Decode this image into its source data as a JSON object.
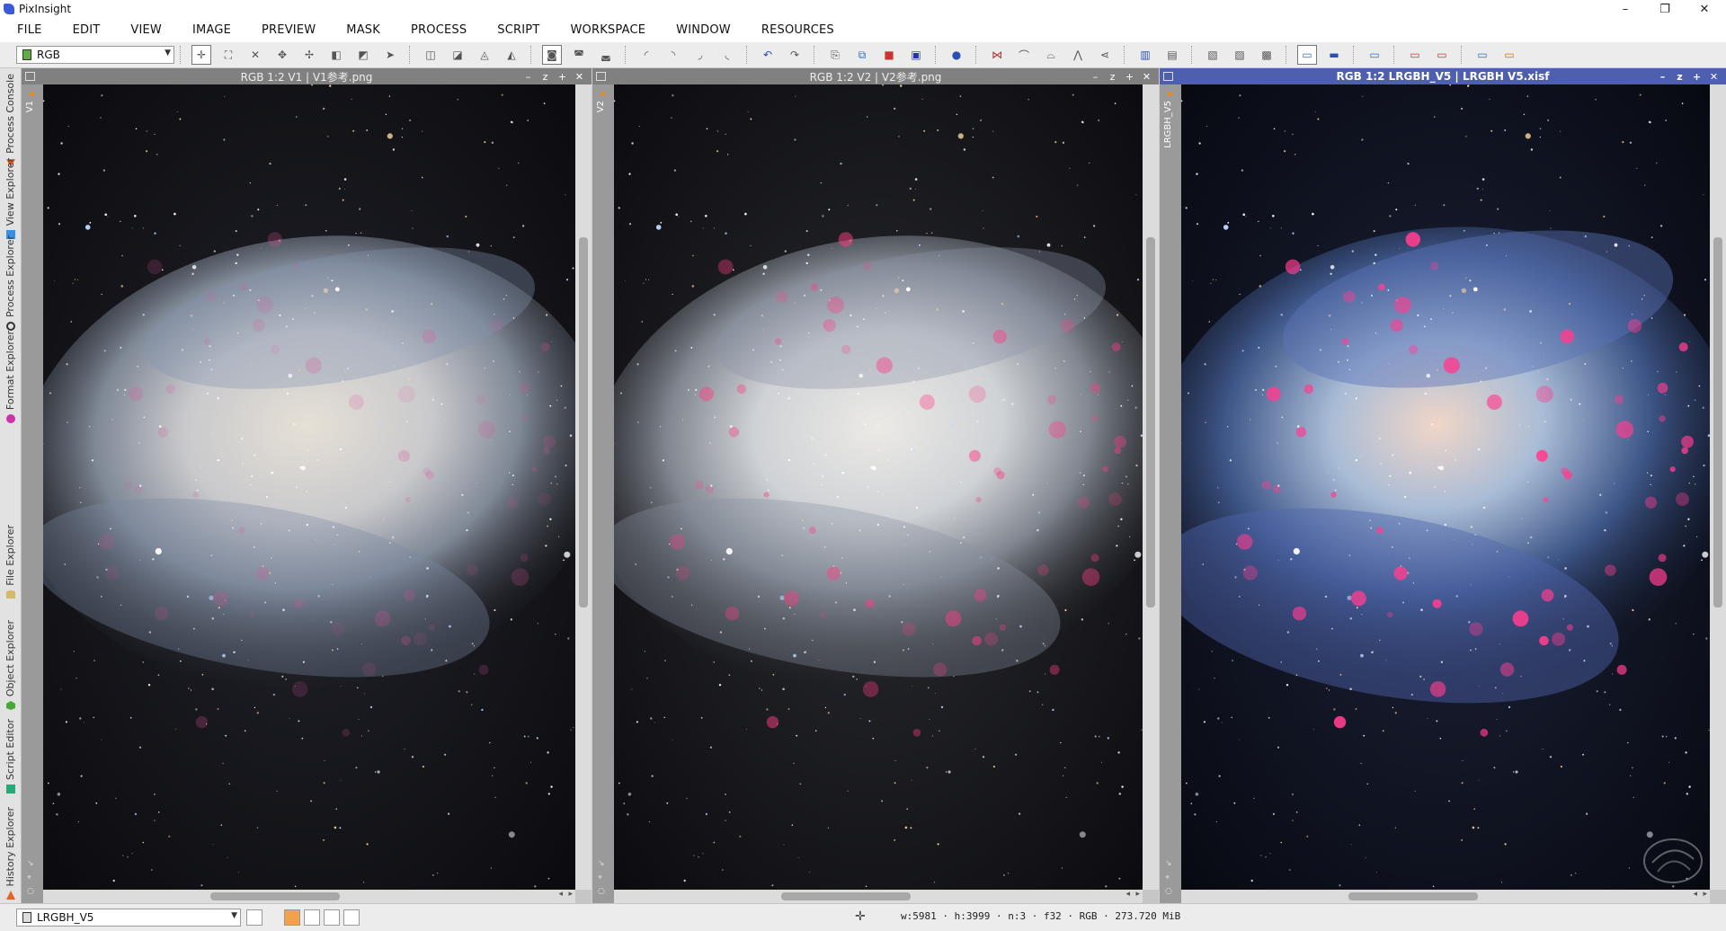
{
  "app": {
    "title": "PixInsight",
    "window_controls": {
      "minimize": "–",
      "maximize": "❐",
      "close": "✕"
    }
  },
  "menu": [
    "FILE",
    "EDIT",
    "VIEW",
    "IMAGE",
    "PREVIEW",
    "MASK",
    "PROCESS",
    "SCRIPT",
    "WORKSPACE",
    "WINDOW",
    "RESOURCES"
  ],
  "toolbar": {
    "view_selector_value": "RGB"
  },
  "left_dock": [
    {
      "label": "Process Console",
      "icon": "console-icon",
      "color": "#e6632a"
    },
    {
      "label": "View Explorer",
      "icon": "view-explorer-icon",
      "color": "#3a8ee6"
    },
    {
      "label": "Process Explorer",
      "icon": "gear-icon",
      "color": "#333333"
    },
    {
      "label": "Format Explorer",
      "icon": "format-icon",
      "color": "#cc33aa"
    },
    {
      "label": "File Explorer",
      "icon": "file-icon",
      "color": "#d6b86a"
    },
    {
      "label": "Object Explorer",
      "icon": "object-icon",
      "color": "#44aa33"
    },
    {
      "label": "Script Editor",
      "icon": "script-icon",
      "color": "#22aa77"
    },
    {
      "label": "History Explorer",
      "icon": "history-icon",
      "color": "#e6632a"
    }
  ],
  "windows": [
    {
      "title": "RGB 1:2 V1 | V1参考.png",
      "view_id": "V1",
      "focused": false,
      "variant": "v1"
    },
    {
      "title": "RGB 1:2 V2 | V2参考.png",
      "view_id": "V2",
      "focused": false,
      "variant": "v2"
    },
    {
      "title": "RGB 1:2 LRGBH_V5 | LRGBH V5.xisf",
      "view_id": "LRGBH_V5",
      "focused": true,
      "variant": "v5"
    }
  ],
  "window_controls": {
    "shade": "–",
    "min": "z",
    "max": "+",
    "close": "✕"
  },
  "statusbar": {
    "view_selector_value": "LRGBH_V5",
    "info": "w:5981 · h:3999 · n:3 · f32 · RGB · 273.720 MiB"
  },
  "colors": {
    "accent": "#4e5fb0",
    "title_inactive": "#808080"
  }
}
